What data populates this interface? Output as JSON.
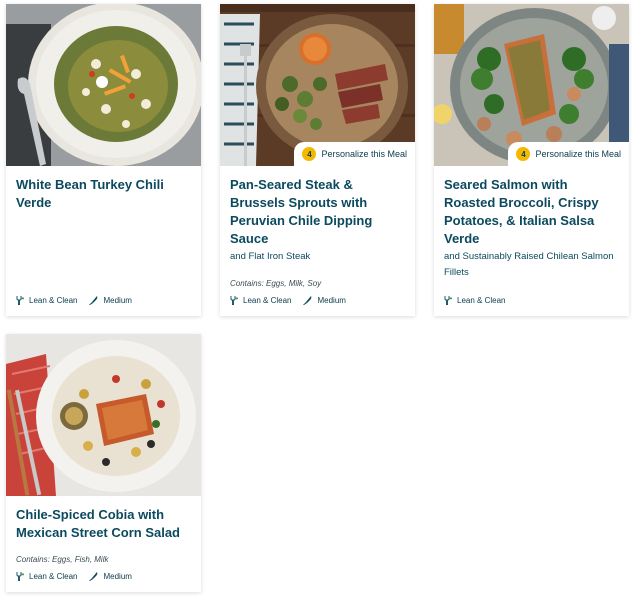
{
  "meals": [
    {
      "title": "White Bean Turkey Chili Verde",
      "subtitle": "",
      "contains": "",
      "personalize": null,
      "tags": [
        {
          "label": "Lean & Clean",
          "icon": "fork-leaf-icon"
        },
        {
          "label": "Medium",
          "icon": "chef-knife-icon"
        }
      ]
    },
    {
      "title": "Pan-Seared Steak & Brussels Sprouts with Peruvian Chile Dipping Sauce",
      "subtitle": "and Flat Iron Steak",
      "contains": "Contains: Eggs, Milk, Soy",
      "personalize": {
        "count": "4",
        "label": "Personalize this Meal"
      },
      "tags": [
        {
          "label": "Lean & Clean",
          "icon": "fork-leaf-icon"
        },
        {
          "label": "Medium",
          "icon": "chef-knife-icon"
        }
      ]
    },
    {
      "title": "Seared Salmon with Roasted Broccoli, Crispy Potatoes, & Italian Salsa Verde",
      "subtitle": "and Sustainably Raised Chilean Salmon Fillets",
      "contains": "",
      "personalize": {
        "count": "4",
        "label": "Personalize this Meal"
      },
      "tags": [
        {
          "label": "Lean & Clean",
          "icon": "fork-leaf-icon"
        }
      ]
    },
    {
      "title": "Chile-Spiced Cobia with Mexican Street Corn Salad",
      "subtitle": "",
      "contains": "Contains: Eggs, Fish, Milk",
      "personalize": null,
      "tags": [
        {
          "label": "Lean & Clean",
          "icon": "fork-leaf-icon"
        },
        {
          "label": "Medium",
          "icon": "chef-knife-icon"
        }
      ]
    }
  ],
  "colors": {
    "title": "#0b4a5e",
    "badge_accent": "#f5b800"
  }
}
